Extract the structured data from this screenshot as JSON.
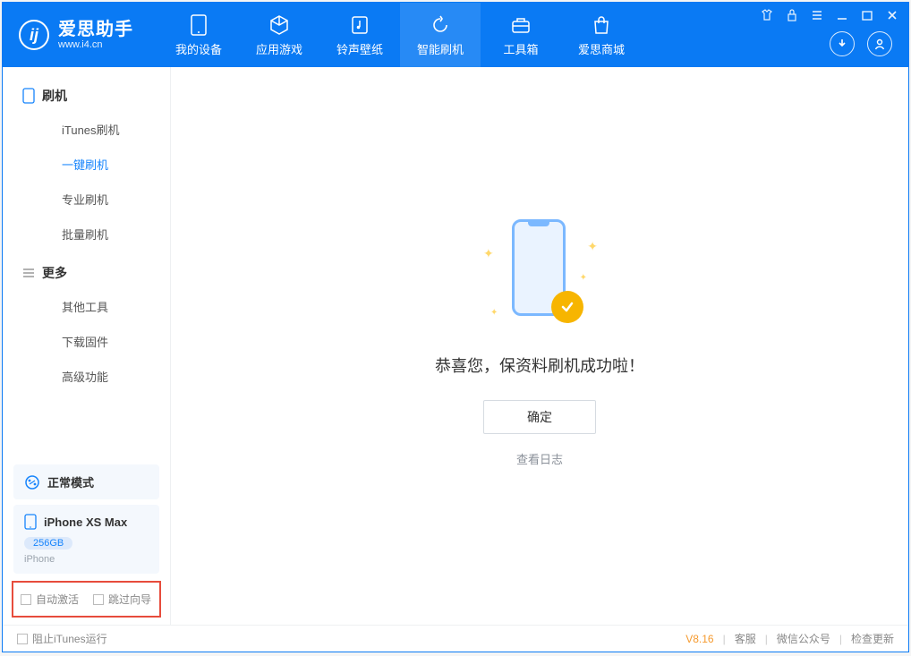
{
  "app": {
    "title": "爱思助手",
    "subtitle": "www.i4.cn"
  },
  "tabs": [
    {
      "label": "我的设备",
      "icon": "device"
    },
    {
      "label": "应用游戏",
      "icon": "cube"
    },
    {
      "label": "铃声壁纸",
      "icon": "music"
    },
    {
      "label": "智能刷机",
      "icon": "refresh"
    },
    {
      "label": "工具箱",
      "icon": "toolbox"
    },
    {
      "label": "爱思商城",
      "icon": "bag"
    }
  ],
  "active_tab_index": 3,
  "sidebar": {
    "section1": {
      "title": "刷机",
      "items": [
        "iTunes刷机",
        "一键刷机",
        "专业刷机",
        "批量刷机"
      ]
    },
    "section2": {
      "title": "更多",
      "items": [
        "其他工具",
        "下载固件",
        "高级功能"
      ]
    },
    "active_item": "一键刷机",
    "mode_label": "正常模式",
    "device": {
      "name": "iPhone XS Max",
      "storage": "256GB",
      "type": "iPhone"
    },
    "checkboxes": {
      "auto_activate": "自动激活",
      "skip_guide": "跳过向导"
    }
  },
  "main": {
    "success_title": "恭喜您，保资料刷机成功啦！",
    "ok_button": "确定",
    "log_link": "查看日志"
  },
  "footer": {
    "block_itunes": "阻止iTunes运行",
    "version": "V8.16",
    "links": [
      "客服",
      "微信公众号",
      "检查更新"
    ]
  }
}
